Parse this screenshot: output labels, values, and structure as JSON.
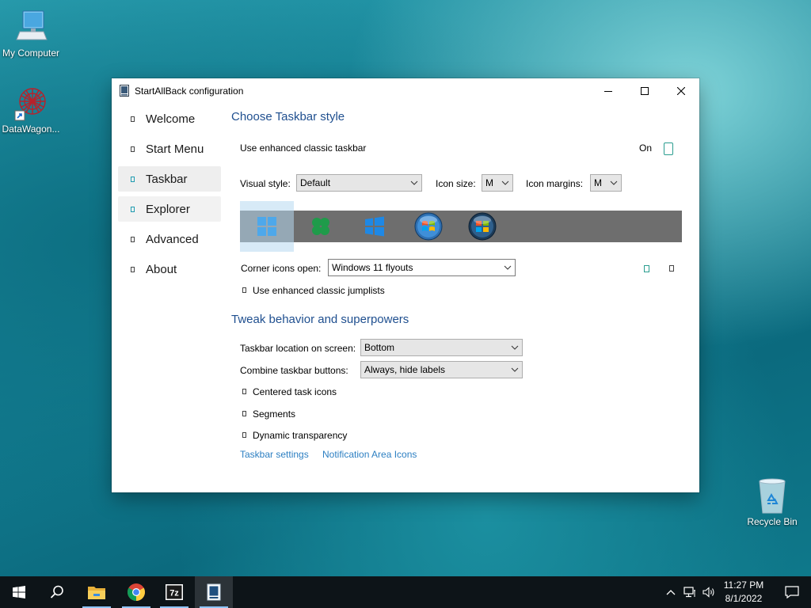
{
  "desktop": {
    "icons": [
      {
        "label": "My Computer"
      },
      {
        "label": "DataWagon..."
      },
      {
        "label": "Recycle Bin"
      }
    ]
  },
  "window": {
    "title": "StartAllBack configuration",
    "nav": [
      {
        "label": "Welcome"
      },
      {
        "label": "Start Menu"
      },
      {
        "label": "Taskbar"
      },
      {
        "label": "Explorer"
      },
      {
        "label": "Advanced"
      },
      {
        "label": "About"
      }
    ],
    "selected_nav": "Taskbar",
    "section1": {
      "heading": "Choose Taskbar style",
      "enhanced_label": "Use enhanced classic taskbar",
      "enhanced_state": "On",
      "visual_style_label": "Visual style:",
      "visual_style_value": "Default",
      "icon_size_label": "Icon size:",
      "icon_size_value": "M",
      "icon_margins_label": "Icon margins:",
      "icon_margins_value": "M",
      "styles": [
        "windows-11-icon",
        "clover-icon",
        "windows-10-icon",
        "windows-7-orb-icon",
        "windows-vista-orb-icon"
      ],
      "selected_style": 0,
      "corner_label": "Corner icons open:",
      "corner_value": "Windows 11 flyouts",
      "jumplists_label": "Use enhanced classic jumplists"
    },
    "section2": {
      "heading": "Tweak behavior and superpowers",
      "location_label": "Taskbar location on screen:",
      "location_value": "Bottom",
      "combine_label": "Combine taskbar buttons:",
      "combine_value": "Always, hide labels",
      "centered_label": "Centered task icons",
      "segments_label": "Segments",
      "dynamic_label": "Dynamic transparency",
      "link1": "Taskbar settings",
      "link2": "Notification Area Icons"
    }
  },
  "taskbar": {
    "time": "11:27 PM",
    "date": "8/1/2022",
    "apps": [
      "start-icon",
      "search-icon",
      "file-explorer-icon",
      "chrome-icon",
      "7zip-icon",
      "startallback-icon"
    ]
  },
  "colors": {
    "heading": "#1f4f8f",
    "link": "#2c7fc2",
    "toggle": "#2a9d8f",
    "taskbar": "#0d1418"
  }
}
